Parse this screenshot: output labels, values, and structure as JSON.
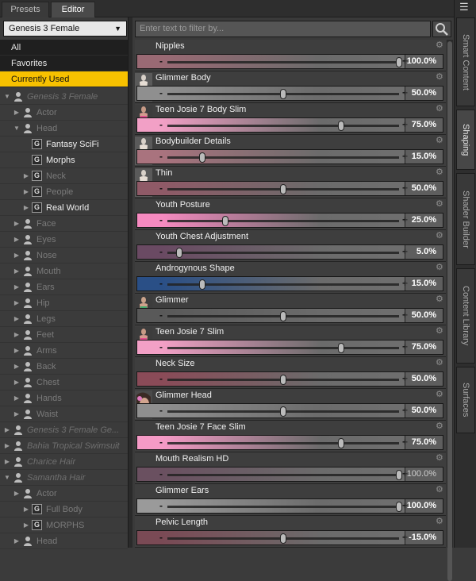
{
  "tabs": [
    {
      "label": "Presets",
      "active": false
    },
    {
      "label": "Editor",
      "active": true
    }
  ],
  "side_tabs": [
    {
      "label": "Smart Content",
      "active": false
    },
    {
      "label": "Shaping",
      "active": true
    },
    {
      "label": "Shader Builder",
      "active": false
    },
    {
      "label": "Content Library",
      "active": false
    },
    {
      "label": "Surfaces",
      "active": false
    }
  ],
  "figure_select": {
    "value": "Genesis 3 Female"
  },
  "categories": [
    {
      "label": "All",
      "active": false
    },
    {
      "label": "Favorites",
      "active": false
    },
    {
      "label": "Currently Used",
      "active": true
    }
  ],
  "tree": [
    {
      "label": "Genesis 3 Female",
      "depth": 0,
      "twist": "open",
      "icon": "figure",
      "style": "ital"
    },
    {
      "label": "Actor",
      "depth": 1,
      "twist": "closed",
      "icon": "figure",
      "style": "dim"
    },
    {
      "label": "Head",
      "depth": 1,
      "twist": "open",
      "icon": "figure",
      "style": "dim"
    },
    {
      "label": "Fantasy SciFi",
      "depth": 2,
      "twist": "none",
      "icon": "group",
      "style": "hi"
    },
    {
      "label": "Morphs",
      "depth": 2,
      "twist": "none",
      "icon": "group",
      "style": "hi"
    },
    {
      "label": "Neck",
      "depth": 2,
      "twist": "closed",
      "icon": "group",
      "style": "dim"
    },
    {
      "label": "People",
      "depth": 2,
      "twist": "closed",
      "icon": "group",
      "style": "dim"
    },
    {
      "label": "Real World",
      "depth": 2,
      "twist": "closed",
      "icon": "group",
      "style": "hi"
    },
    {
      "label": "Face",
      "depth": 1,
      "twist": "closed",
      "icon": "figure",
      "style": "dim"
    },
    {
      "label": "Eyes",
      "depth": 1,
      "twist": "closed",
      "icon": "figure",
      "style": "dim"
    },
    {
      "label": "Nose",
      "depth": 1,
      "twist": "closed",
      "icon": "figure",
      "style": "dim"
    },
    {
      "label": "Mouth",
      "depth": 1,
      "twist": "closed",
      "icon": "figure",
      "style": "dim"
    },
    {
      "label": "Ears",
      "depth": 1,
      "twist": "closed",
      "icon": "figure",
      "style": "dim"
    },
    {
      "label": "Hip",
      "depth": 1,
      "twist": "closed",
      "icon": "figure",
      "style": "dim"
    },
    {
      "label": "Legs",
      "depth": 1,
      "twist": "closed",
      "icon": "figure",
      "style": "dim"
    },
    {
      "label": "Feet",
      "depth": 1,
      "twist": "closed",
      "icon": "figure",
      "style": "dim"
    },
    {
      "label": "Arms",
      "depth": 1,
      "twist": "closed",
      "icon": "figure",
      "style": "dim"
    },
    {
      "label": "Back",
      "depth": 1,
      "twist": "closed",
      "icon": "figure",
      "style": "dim"
    },
    {
      "label": "Chest",
      "depth": 1,
      "twist": "closed",
      "icon": "figure",
      "style": "dim"
    },
    {
      "label": "Hands",
      "depth": 1,
      "twist": "closed",
      "icon": "figure",
      "style": "dim"
    },
    {
      "label": "Waist",
      "depth": 1,
      "twist": "closed",
      "icon": "figure",
      "style": "dim"
    },
    {
      "label": "Genesis 3 Female Ge...",
      "depth": 0,
      "twist": "closed",
      "icon": "figure",
      "style": "ital"
    },
    {
      "label": "Bahia Tropical Swimsuit",
      "depth": 0,
      "twist": "closed",
      "icon": "figure",
      "style": "ital"
    },
    {
      "label": "Charice Hair",
      "depth": 0,
      "twist": "closed",
      "icon": "figure",
      "style": "ital"
    },
    {
      "label": "Samantha Hair",
      "depth": 0,
      "twist": "open",
      "icon": "figure",
      "style": "ital"
    },
    {
      "label": "Actor",
      "depth": 1,
      "twist": "closed",
      "icon": "figure",
      "style": "dim"
    },
    {
      "label": "Full Body",
      "depth": 2,
      "twist": "closed",
      "icon": "group",
      "style": "dim"
    },
    {
      "label": "MORPHS",
      "depth": 2,
      "twist": "closed",
      "icon": "group",
      "style": "dim"
    },
    {
      "label": "Head",
      "depth": 1,
      "twist": "closed",
      "icon": "figure",
      "style": "dim"
    }
  ],
  "filter": {
    "placeholder": "Enter text to filter by..."
  },
  "properties": [
    {
      "name": "Nipples",
      "value": "100.0%",
      "level": 1.0,
      "color": "#9a6a74",
      "thumb": "none",
      "bold": true
    },
    {
      "name": "Glimmer Body",
      "value": "50.0%",
      "level": 0.5,
      "color": "#8f8f8f",
      "thumb": "body",
      "bold": true
    },
    {
      "name": "Teen Josie 7 Body Slim",
      "value": "75.0%",
      "level": 0.75,
      "color": "#f2a0c6",
      "thumb": "pink",
      "bold": true
    },
    {
      "name": "Bodybuilder Details",
      "value": "15.0%",
      "level": 0.15,
      "color": "#a9737e",
      "thumb": "body",
      "bold": true
    },
    {
      "name": "Thin",
      "value": "50.0%",
      "level": 0.5,
      "color": "#8f5a67",
      "thumb": "body",
      "bold": true
    },
    {
      "name": "Youth Posture",
      "value": "25.0%",
      "level": 0.25,
      "color": "#f68ac0",
      "thumb": "none",
      "bold": true
    },
    {
      "name": "Youth Chest Adjustment",
      "value": "5.0%",
      "level": 0.05,
      "color": "#6a4a63",
      "thumb": "none",
      "bold": true
    },
    {
      "name": "Androgynous Shape",
      "value": "15.0%",
      "level": 0.15,
      "color": "#2a4f86",
      "thumb": "none",
      "bold": true
    },
    {
      "name": "Glimmer",
      "value": "50.0%",
      "level": 0.5,
      "color": "#595959",
      "thumb": "swim",
      "bold": true
    },
    {
      "name": "Teen Josie 7 Slim",
      "value": "75.0%",
      "level": 0.75,
      "color": "#f2a0c6",
      "thumb": "pink",
      "bold": true
    },
    {
      "name": "Neck Size",
      "value": "50.0%",
      "level": 0.5,
      "color": "#8a4b58",
      "thumb": "none",
      "bold": true
    },
    {
      "name": "Glimmer Head",
      "value": "50.0%",
      "level": 0.5,
      "color": "#8f8f8f",
      "thumb": "head",
      "bold": true
    },
    {
      "name": "Teen Josie 7 Face Slim",
      "value": "75.0%",
      "level": 0.75,
      "color": "#f59ac6",
      "thumb": "none",
      "bold": true
    },
    {
      "name": "Mouth Realism HD",
      "value": "100.0%",
      "level": 1.0,
      "color": "#6a5060",
      "thumb": "none",
      "bold": false
    },
    {
      "name": "Glimmer Ears",
      "value": "100.0%",
      "level": 1.0,
      "color": "#9a9a9a",
      "thumb": "none",
      "bold": true
    },
    {
      "name": "Pelvic Length",
      "value": "-15.0%",
      "level": 0.5,
      "color": "#7a4a55",
      "thumb": "none",
      "bold": true
    }
  ]
}
